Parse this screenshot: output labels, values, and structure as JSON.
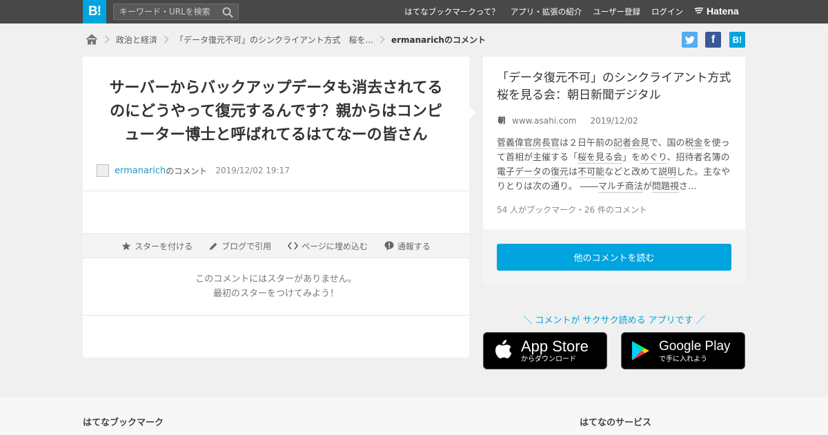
{
  "header": {
    "logo": "B!",
    "search_placeholder": "キーワード・URLを検索",
    "nav": [
      "はてなブックマークって？",
      "アプリ・拡張の紹介",
      "ユーザー登録",
      "ログイン"
    ],
    "brand": "Hatena"
  },
  "breadcrumb": {
    "items": [
      "政治と経済",
      "「データ復元不可」のシンクライアント方式　桜を..."
    ],
    "current": "ermanarichのコメント"
  },
  "share": {
    "twitter": "t",
    "facebook": "f",
    "hatebu": "B!"
  },
  "comment": {
    "text": "サーバーからバックアップデータも消去されてるのにどうやって復元するんです？親からはコンピューター博士と呼ばれてるはてなーの皆さん",
    "user": "ermanarich",
    "user_suffix": "のコメント",
    "datetime": "2019/12/02 19:17"
  },
  "actions": [
    "スターを付ける",
    "ブログで引用",
    "ページに埋め込む",
    "通報する"
  ],
  "stars": {
    "line1": "このコメントにはスターがありません。",
    "line2": "最初のスターをつけてみよう！"
  },
  "entry": {
    "title": "「データ復元不可」のシンクライアント方式　桜を見る会：朝日新聞デジタル",
    "favicon": "朝",
    "domain": "www.asahi.com",
    "date": "2019/12/02",
    "excerpt": [
      {
        "t": "菅義偉官房長官",
        "u": true
      },
      {
        "t": "は２日午前の",
        "u": false
      },
      {
        "t": "記者会見",
        "u": true
      },
      {
        "t": "で、国の",
        "u": false
      },
      {
        "t": "税金",
        "u": true
      },
      {
        "t": "を使って首相が主催する「",
        "u": false
      },
      {
        "t": "桜を見る会",
        "u": true
      },
      {
        "t": "」を",
        "u": false
      },
      {
        "t": "めぐり",
        "u": true
      },
      {
        "t": "、招待者名簿の",
        "u": false
      },
      {
        "t": "電子データ",
        "u": true
      },
      {
        "t": "の",
        "u": false
      },
      {
        "t": "復元",
        "u": true
      },
      {
        "t": "は",
        "u": false
      },
      {
        "t": "不可能",
        "u": true
      },
      {
        "t": "などと改めて",
        "u": false
      },
      {
        "t": "説明",
        "u": true
      },
      {
        "t": "した。主なやりとりは次の通り。 ――",
        "u": false
      },
      {
        "t": "マルチ商法",
        "u": true
      },
      {
        "t": "が",
        "u": false
      },
      {
        "t": "問題視",
        "u": true
      },
      {
        "t": "さ…",
        "u": false
      }
    ],
    "counts": "54 人がブックマーク・26 件のコメント",
    "read_button": "他のコメントを読む"
  },
  "promo": {
    "text": "＼ コメントが サクサク読める アプリです ／",
    "appstore_big": "App Store",
    "appstore_small": "からダウンロード",
    "googleplay_big": "Google Play",
    "googleplay_small": "で手に入れよう"
  },
  "footer": {
    "left": "はてなブックマーク",
    "right": "はてなのサービス"
  },
  "colors": {
    "accent": "#00a4de",
    "topbar": "#484848",
    "twitter": "#55acee",
    "facebook": "#3b5998"
  }
}
